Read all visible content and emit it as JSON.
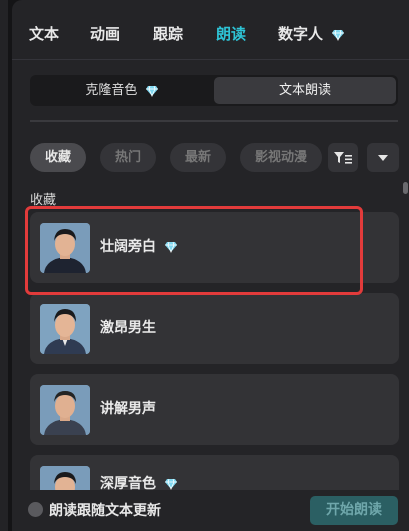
{
  "tabs": [
    {
      "label": "文本",
      "active": false
    },
    {
      "label": "动画",
      "active": false
    },
    {
      "label": "跟踪",
      "active": false
    },
    {
      "label": "朗读",
      "active": true
    },
    {
      "label": "数字人",
      "active": false,
      "premium": true
    }
  ],
  "mode_switch": {
    "clone_label": "克隆音色",
    "tts_label": "文本朗读",
    "selected": "文本朗读"
  },
  "filters": {
    "chips": [
      {
        "label": "收藏",
        "active": true
      },
      {
        "label": "热门",
        "active": false
      },
      {
        "label": "最新",
        "active": false
      },
      {
        "label": "影视动漫",
        "active": false
      }
    ],
    "filter_icon": "filter-list-icon",
    "dropdown_icon": "caret-down-icon"
  },
  "section": {
    "title": "收藏"
  },
  "voices": [
    {
      "name": "壮阔旁白",
      "premium": true
    },
    {
      "name": "激昂男生",
      "premium": false
    },
    {
      "name": "讲解男声",
      "premium": false
    },
    {
      "name": "深厚音色",
      "premium": true
    }
  ],
  "footer": {
    "follow_text_label": "朗读跟随文本更新",
    "follow_text_checked": false,
    "start_button_label": "开始朗读"
  },
  "colors": {
    "accent": "#2ec4d6",
    "highlight_border": "#e23b3b",
    "premium_diamond": "#7fd8f0",
    "start_button_bg": "#2b5f63"
  }
}
